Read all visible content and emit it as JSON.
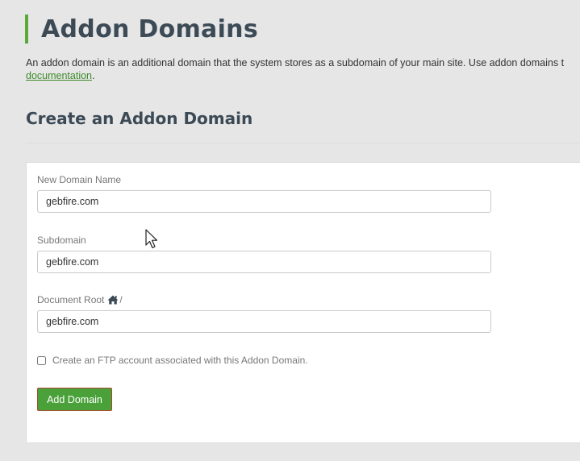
{
  "page": {
    "title": "Addon Domains",
    "description_text": "An addon domain is an additional domain that the system stores as a subdomain of your main site. Use addon domains t",
    "description_link": "documentation",
    "description_after_link": "."
  },
  "section": {
    "title": "Create an Addon Domain"
  },
  "form": {
    "new_domain": {
      "label": "New Domain Name",
      "value": "gebfire.com"
    },
    "subdomain": {
      "label": "Subdomain",
      "value": "gebfire.com"
    },
    "document_root": {
      "label": "Document Root",
      "suffix": "/",
      "icon": "home-icon",
      "value": "gebfire.com"
    },
    "ftp_checkbox": {
      "label": "Create an FTP account associated with this Addon Domain.",
      "checked": false
    },
    "submit_label": "Add Domain"
  },
  "colors": {
    "accent": "#5aaa3a",
    "button_bg": "#4aa13a",
    "button_border": "#a84a2a",
    "title": "#3c4a56",
    "link": "#3d8b2a"
  }
}
